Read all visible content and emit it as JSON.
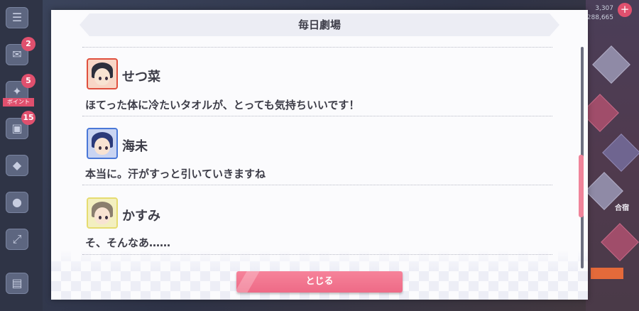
{
  "dialog": {
    "title": "毎日劇場",
    "entries": [
      {
        "speaker": "せつ菜",
        "avatar_icon": "setsuna-avatar-icon",
        "line": "ほてった体に冷たいタオルが、とっても気持ちいいです！"
      },
      {
        "speaker": "海未",
        "avatar_icon": "umi-avatar-icon",
        "line": "本当に。汗がすっと引いていきますね"
      },
      {
        "speaker": "かすみ",
        "avatar_icon": "kasumi-avatar-icon",
        "line": "そ、そんなあ……"
      }
    ],
    "close_label": "とじる",
    "scroll_position": 0.55
  },
  "background": {
    "badges": [
      "2",
      "5",
      "15"
    ],
    "event_tag": "ボイント",
    "top_right_values": [
      "3,307",
      "288,665"
    ],
    "right_label": "合宿"
  },
  "colors": {
    "accent": "#ee6a86",
    "text": "#3d3d48",
    "setsuna_frame": "#e0503e",
    "umi_frame": "#4a78d8",
    "kasumi_frame": "#e6dc70"
  }
}
